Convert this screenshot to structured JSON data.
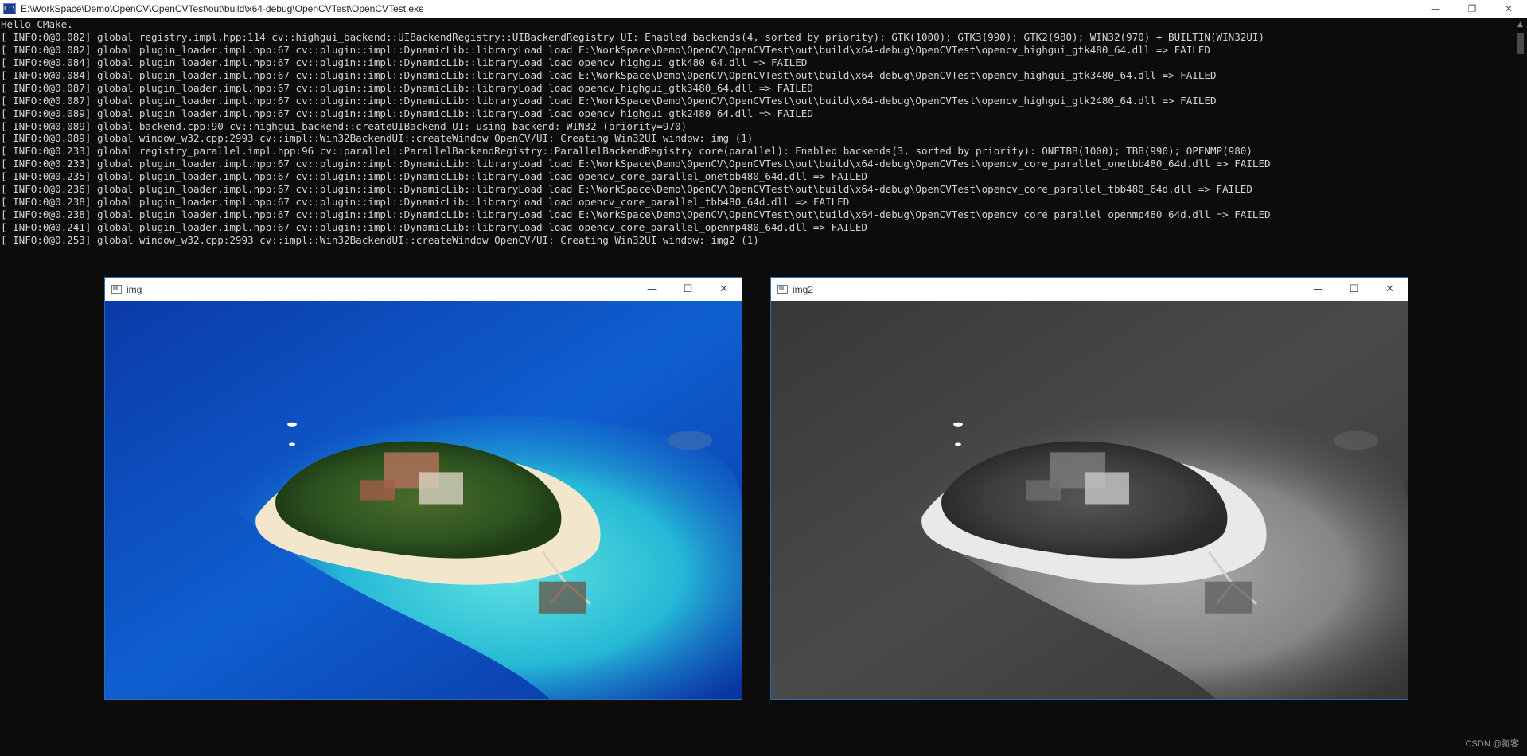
{
  "console": {
    "title": "E:\\WorkSpace\\Demo\\OpenCV\\OpenCVTest\\out\\build\\x64-debug\\OpenCVTest\\OpenCVTest.exe",
    "icon": "console-app-icon",
    "controls": {
      "minimize": "—",
      "restore": "❐",
      "close": "✕"
    },
    "lines": [
      "Hello CMake.",
      "[ INFO:0@0.082] global registry.impl.hpp:114 cv::highgui_backend::UIBackendRegistry::UIBackendRegistry UI: Enabled backends(4, sorted by priority): GTK(1000); GTK3(990); GTK2(980); WIN32(970) + BUILTIN(WIN32UI)",
      "[ INFO:0@0.082] global plugin_loader.impl.hpp:67 cv::plugin::impl::DynamicLib::libraryLoad load E:\\WorkSpace\\Demo\\OpenCV\\OpenCVTest\\out\\build\\x64-debug\\OpenCVTest\\opencv_highgui_gtk480_64.dll => FAILED",
      "[ INFO:0@0.084] global plugin_loader.impl.hpp:67 cv::plugin::impl::DynamicLib::libraryLoad load opencv_highgui_gtk480_64.dll => FAILED",
      "[ INFO:0@0.084] global plugin_loader.impl.hpp:67 cv::plugin::impl::DynamicLib::libraryLoad load E:\\WorkSpace\\Demo\\OpenCV\\OpenCVTest\\out\\build\\x64-debug\\OpenCVTest\\opencv_highgui_gtk3480_64.dll => FAILED",
      "[ INFO:0@0.087] global plugin_loader.impl.hpp:67 cv::plugin::impl::DynamicLib::libraryLoad load opencv_highgui_gtk3480_64.dll => FAILED",
      "[ INFO:0@0.087] global plugin_loader.impl.hpp:67 cv::plugin::impl::DynamicLib::libraryLoad load E:\\WorkSpace\\Demo\\OpenCV\\OpenCVTest\\out\\build\\x64-debug\\OpenCVTest\\opencv_highgui_gtk2480_64.dll => FAILED",
      "[ INFO:0@0.089] global plugin_loader.impl.hpp:67 cv::plugin::impl::DynamicLib::libraryLoad load opencv_highgui_gtk2480_64.dll => FAILED",
      "[ INFO:0@0.089] global backend.cpp:90 cv::highgui_backend::createUIBackend UI: using backend: WIN32 (priority=970)",
      "[ INFO:0@0.089] global window_w32.cpp:2993 cv::impl::Win32BackendUI::createWindow OpenCV/UI: Creating Win32UI window: img (1)",
      "[ INFO:0@0.233] global registry_parallel.impl.hpp:96 cv::parallel::ParallelBackendRegistry::ParallelBackendRegistry core(parallel): Enabled backends(3, sorted by priority): ONETBB(1000); TBB(990); OPENMP(980)",
      "[ INFO:0@0.233] global plugin_loader.impl.hpp:67 cv::plugin::impl::DynamicLib::libraryLoad load E:\\WorkSpace\\Demo\\OpenCV\\OpenCVTest\\out\\build\\x64-debug\\OpenCVTest\\opencv_core_parallel_onetbb480_64d.dll => FAILED",
      "[ INFO:0@0.235] global plugin_loader.impl.hpp:67 cv::plugin::impl::DynamicLib::libraryLoad load opencv_core_parallel_onetbb480_64d.dll => FAILED",
      "[ INFO:0@0.236] global plugin_loader.impl.hpp:67 cv::plugin::impl::DynamicLib::libraryLoad load E:\\WorkSpace\\Demo\\OpenCV\\OpenCVTest\\out\\build\\x64-debug\\OpenCVTest\\opencv_core_parallel_tbb480_64d.dll => FAILED",
      "[ INFO:0@0.238] global plugin_loader.impl.hpp:67 cv::plugin::impl::DynamicLib::libraryLoad load opencv_core_parallel_tbb480_64d.dll => FAILED",
      "[ INFO:0@0.238] global plugin_loader.impl.hpp:67 cv::plugin::impl::DynamicLib::libraryLoad load E:\\WorkSpace\\Demo\\OpenCV\\OpenCVTest\\out\\build\\x64-debug\\OpenCVTest\\opencv_core_parallel_openmp480_64d.dll => FAILED",
      "[ INFO:0@0.241] global plugin_loader.impl.hpp:67 cv::plugin::impl::DynamicLib::libraryLoad load opencv_core_parallel_openmp480_64d.dll => FAILED",
      "[ INFO:0@0.253] global window_w32.cpp:2993 cv::impl::Win32BackendUI::createWindow OpenCV/UI: Creating Win32UI window: img2 (1)"
    ],
    "colors": {
      "background": "#0c0c0c",
      "text": "#d4d4d4"
    }
  },
  "windows": {
    "img": {
      "title": "img",
      "icon": "image-window-icon",
      "controls": {
        "minimize": "—",
        "maximize": "☐",
        "close": "✕"
      },
      "content": "color-island-photo",
      "colors": {
        "ocean_deep": "#0a3fb0",
        "ocean_light": "#2ad0d8",
        "sand": "#f4ead2",
        "forest": "#2f5a1f"
      }
    },
    "img2": {
      "title": "img2",
      "icon": "image-window-icon",
      "controls": {
        "minimize": "—",
        "maximize": "☐",
        "close": "✕"
      },
      "content": "grayscale-island-photo",
      "colors": {
        "ocean_deep": "#3a3a3a",
        "ocean_light": "#8a8a8a",
        "sand": "#e8e8e8",
        "forest": "#3c3c3c"
      }
    }
  },
  "watermark": "CSDN @氮客"
}
